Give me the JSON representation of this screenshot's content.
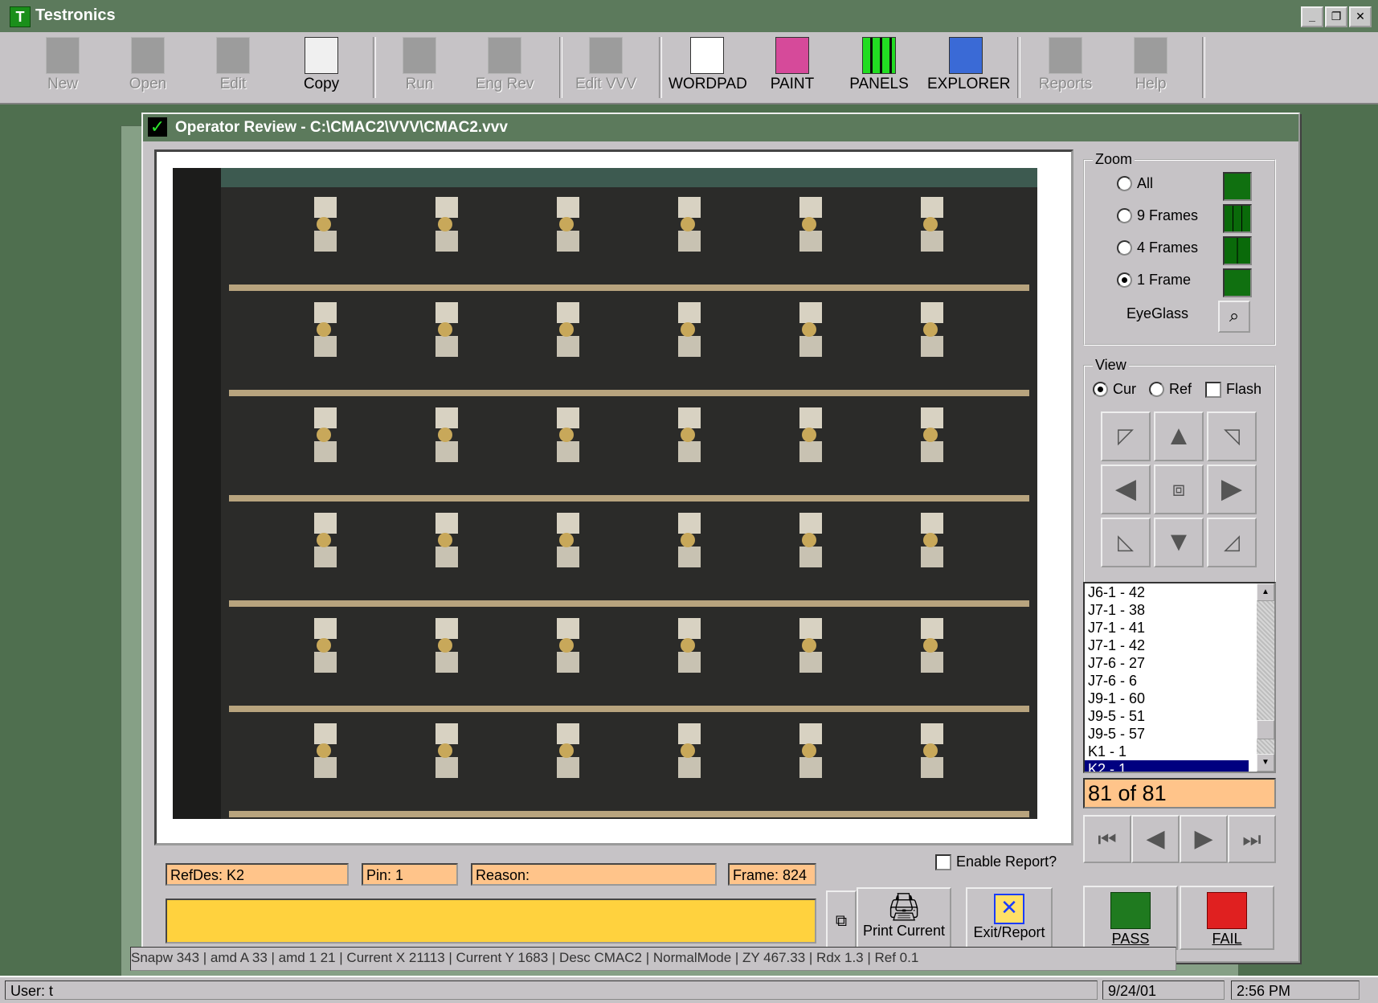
{
  "app": {
    "title": "Testronics",
    "icon_letter": "T"
  },
  "toolbar": {
    "buttons": [
      {
        "label": "New",
        "icon": "new-file-icon",
        "enabled": false
      },
      {
        "label": "Open",
        "icon": "open-folder-icon",
        "enabled": false
      },
      {
        "label": "Edit",
        "icon": "pencil-icon",
        "enabled": false
      },
      {
        "label": "Copy",
        "icon": "copy-icon",
        "enabled": true
      },
      {
        "label": "Run",
        "icon": "run-icon",
        "enabled": false
      },
      {
        "label": "Eng Rev",
        "icon": "eng-rev-icon",
        "enabled": false
      },
      {
        "label": "Edit VVV",
        "icon": "edit-vvv-icon",
        "enabled": false
      },
      {
        "label": "WORDPAD",
        "icon": "wordpad-icon",
        "enabled": true
      },
      {
        "label": "PAINT",
        "icon": "paint-icon",
        "enabled": true
      },
      {
        "label": "PANELS",
        "icon": "panels-grid-icon",
        "enabled": true
      },
      {
        "label": "EXPLORER",
        "icon": "explorer-computer-icon",
        "enabled": true
      },
      {
        "label": "Reports",
        "icon": "reports-icon",
        "enabled": false
      },
      {
        "label": "Help",
        "icon": "help-question-icon",
        "enabled": false
      }
    ]
  },
  "dialog": {
    "title": "Operator Review - C:\\CMAC2\\VVV\\CMAC2.vvv",
    "zoom": {
      "legend": "Zoom",
      "options": [
        {
          "label": "All",
          "selected": false
        },
        {
          "label": "9 Frames",
          "selected": false
        },
        {
          "label": "4 Frames",
          "selected": false
        },
        {
          "label": "1 Frame",
          "selected": true
        }
      ],
      "eyeglass_label": "EyeGlass"
    },
    "view": {
      "legend": "View",
      "cur_label": "Cur",
      "ref_label": "Ref",
      "flash_label": "Flash",
      "selected": "Cur"
    },
    "defects": {
      "items": [
        "J6-1 - 42",
        "J7-1 - 38",
        "J7-1 - 41",
        "J7-1 - 42",
        "J7-6 - 27",
        "J7-6 - 6",
        "J9-1 - 60",
        "J9-5 - 51",
        "J9-5 - 57",
        "K1 - 1",
        "K2 - 1"
      ],
      "selected_index": 10
    },
    "counter": "81 of 81",
    "fields": {
      "refdes": "RefDes: K2",
      "pin": "Pin: 1",
      "reason": "Reason:",
      "frame": "Frame: 824"
    },
    "enable_report_label": "Enable Report?",
    "buttons": {
      "print": "Print Current",
      "exit": "Exit/Report",
      "pass": "PASS",
      "fail": "FAIL"
    },
    "colors": {
      "pass": "#1f7a1f",
      "fail": "#e02020",
      "counter_bg": "#ffc48a",
      "message_bg": "#ffd23e"
    }
  },
  "status_strip": "Snapw 343 | amd A 33 | amd 1 21 | Current X 21113 | Current Y 1683 | Desc CMAC2 | NormalMode | ZY 467.33 | Rdx 1.3 | Ref 0.1",
  "statusbar": {
    "user": "User: t",
    "date": "9/24/01",
    "time": "2:56 PM"
  }
}
